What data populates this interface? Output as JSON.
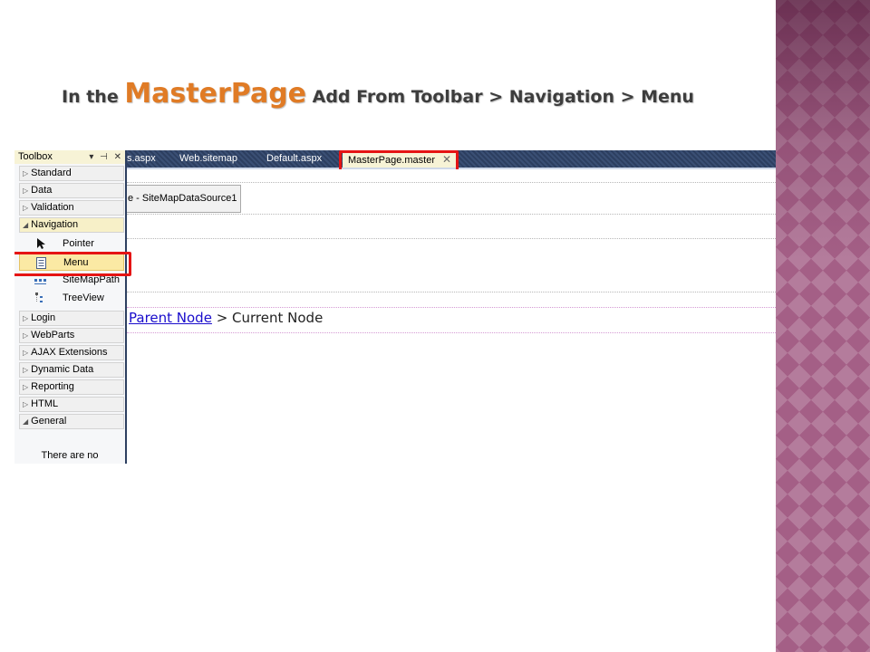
{
  "slide": {
    "title_prefix": "In the ",
    "title_emphasis": "MasterPage",
    "title_suffix": " Add From Toolbar > Navigation > Menu"
  },
  "tabs": [
    {
      "label": "s.aspx"
    },
    {
      "label": "Web.sitemap"
    },
    {
      "label": "Default.aspx"
    },
    {
      "label": "MasterPage.master",
      "active": true,
      "close": "✕"
    }
  ],
  "design": {
    "datasource_label": "e - SiteMapDataSource1",
    "breadcrumb": {
      "parent": "Parent Node",
      "separator": " > ",
      "current": "Current Node"
    }
  },
  "toolbox": {
    "title": "Toolbox",
    "controls": "▾ ⊣ ✕",
    "categories_top": [
      {
        "label": "Standard"
      },
      {
        "label": "Data"
      },
      {
        "label": "Validation"
      },
      {
        "label": "Navigation",
        "expanded": true
      }
    ],
    "navigation_items": [
      {
        "label": "Pointer",
        "icon": "pointer-icon"
      },
      {
        "label": "Menu",
        "icon": "menu-icon",
        "selected": true
      },
      {
        "label": "SiteMapPath",
        "icon": "sitemappath-icon"
      },
      {
        "label": "TreeView",
        "icon": "treeview-icon"
      }
    ],
    "categories_bottom": [
      {
        "label": "Login"
      },
      {
        "label": "WebParts"
      },
      {
        "label": "AJAX Extensions"
      },
      {
        "label": "Dynamic Data"
      },
      {
        "label": "Reporting"
      },
      {
        "label": "HTML"
      },
      {
        "label": "General",
        "expanded": true
      }
    ],
    "empty_text": "There are no"
  },
  "colors": {
    "accent_orange": "#e07b25",
    "highlight_red": "#e51414",
    "tabstrip_navy": "#2d3f60",
    "side_strip": "#a45f86"
  }
}
